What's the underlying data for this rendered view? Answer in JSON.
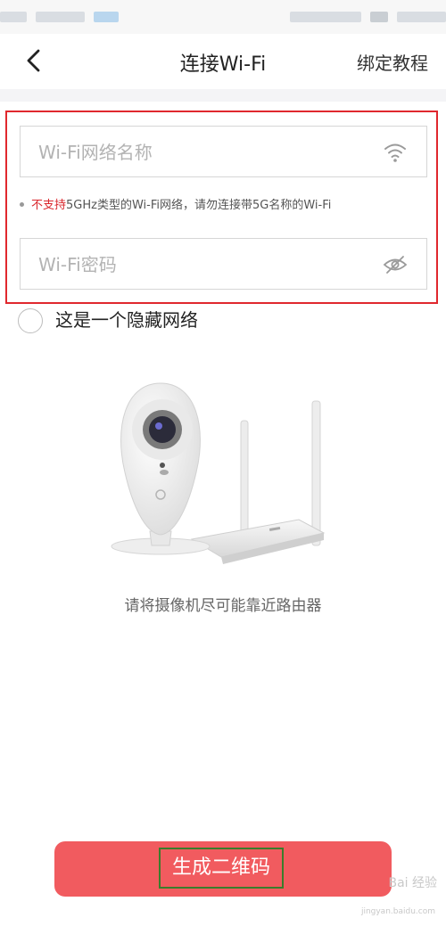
{
  "nav": {
    "title": "连接Wi-Fi",
    "tutorial_label": "绑定教程"
  },
  "wifi": {
    "ssid_placeholder": "Wi-Fi网络名称",
    "ssid_value": "",
    "password_placeholder": "Wi-Fi密码",
    "password_value": ""
  },
  "note": {
    "highlight": "不支持",
    "text": "5GHz类型的Wi-Fi网络，请勿连接带5G名称的Wi-Fi"
  },
  "hidden_network": {
    "label": "这是一个隐藏网络",
    "checked": false
  },
  "illustration": {
    "hint": "请将摄像机尽可能靠近路由器"
  },
  "primary_button": {
    "label": "生成二维码"
  },
  "watermark": {
    "text": "Bai 经验",
    "sub": "jingyan.baidu.com"
  },
  "colors": {
    "accent_red": "#e0282e",
    "button": "#f15b5f",
    "highlight_green": "#3a7d2c"
  }
}
